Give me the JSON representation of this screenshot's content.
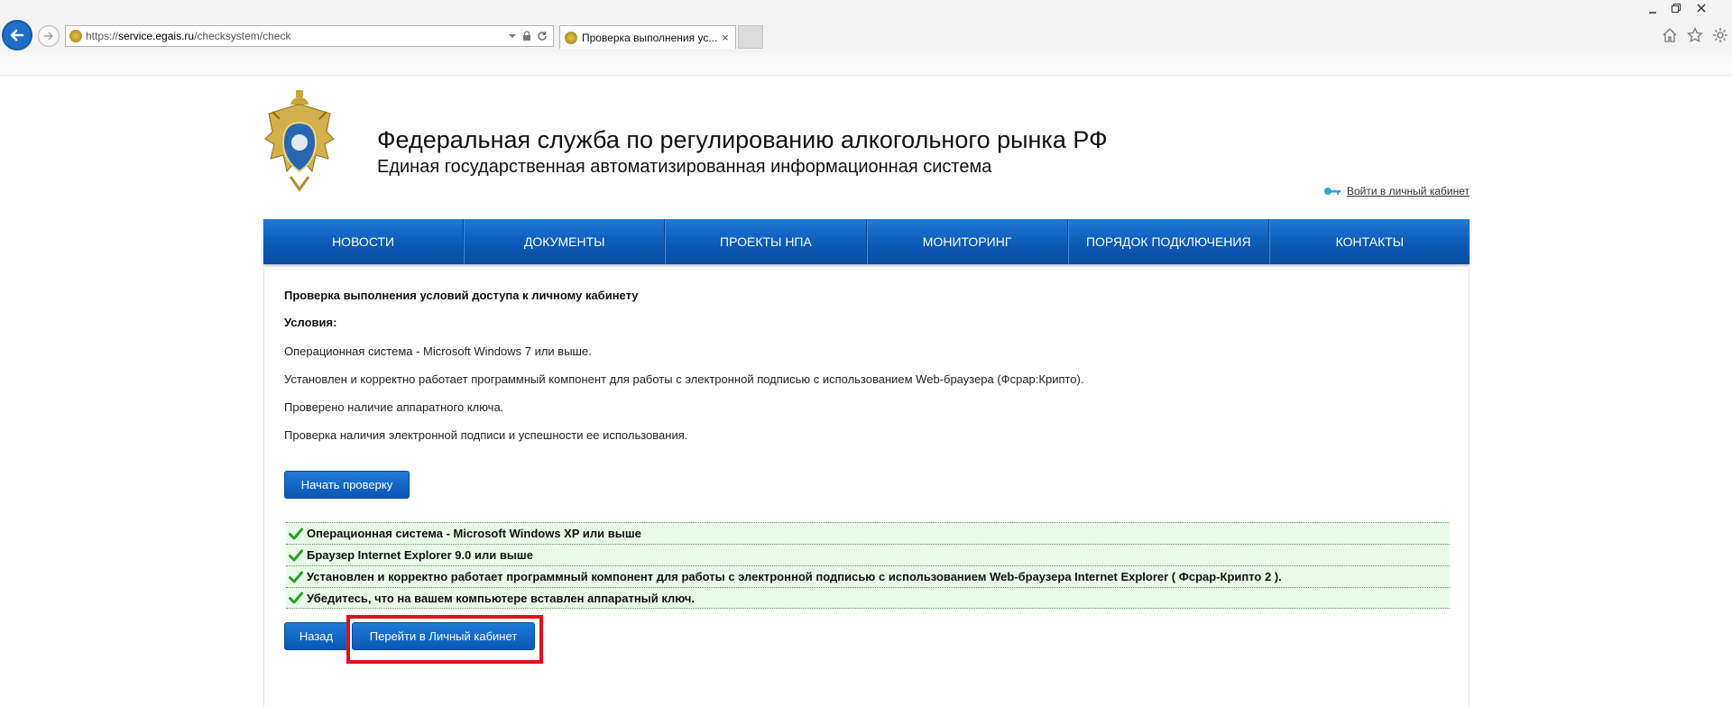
{
  "browser": {
    "url_prefix": "https://",
    "url_domain": "service.egais.ru",
    "url_path": "/checksystem/check",
    "tab_title": "Проверка выполнения ус...",
    "tab_close": "×"
  },
  "header": {
    "title": "Федеральная служба по регулированию алкогольного рынка РФ",
    "subtitle": "Единая государственная автоматизированная информационная система",
    "login_link": "Войти в личный кабинет"
  },
  "menu": {
    "items": [
      {
        "label": "НОВОСТИ"
      },
      {
        "label": "ДОКУМЕНТЫ"
      },
      {
        "label": "ПРОЕКТЫ НПА"
      },
      {
        "label": "МОНИТОРИНГ"
      },
      {
        "label": "ПОРЯДОК ПОДКЛЮЧЕНИЯ"
      },
      {
        "label": "КОНТАКТЫ"
      }
    ]
  },
  "content": {
    "title": "Проверка выполнения условий доступа к личному кабинету",
    "conditions_heading": "Условия:",
    "conditions": [
      "Операционная система - Microsoft Windows 7 или выше.",
      "Установлен и корректно работает программный компонент для работы с электронной подписью с использованием Web-браузера (Фсрар:Крипто).",
      "Проверено наличие аппаратного ключа.",
      "Проверка наличия электронной подписи и успешности ее использования."
    ],
    "start_button": "Начать проверку",
    "check_results": [
      "Операционная система - Microsoft Windows XP или выше",
      "Браузер Internet Explorer 9.0 или выше",
      "Установлен и корректно работает программный компонент для работы с электронной подписью с использованием Web-браузера Internet Explorer ( Фсрар-Крипто 2 ).",
      "Убедитесь, что на вашем компьютере вставлен аппаратный ключ."
    ],
    "back_button": "Назад",
    "cabinet_button": "Перейти в Личный кабинет"
  },
  "colors": {
    "accent_blue": "#0a57b4",
    "check_green": "#2aa02a",
    "result_bg": "#e8fbe8",
    "highlight_red": "#e0101a"
  }
}
